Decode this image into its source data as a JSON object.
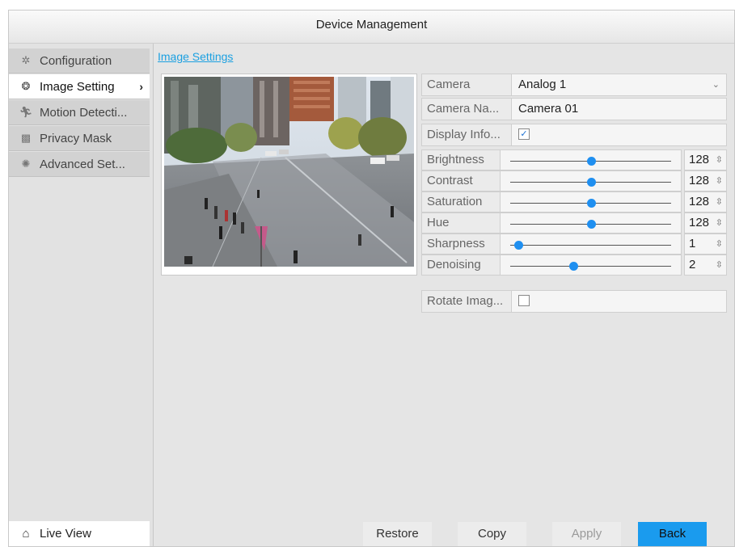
{
  "window": {
    "title": "Device Management"
  },
  "sidebar": {
    "items": [
      {
        "label": "Configuration",
        "icon": "gear-icon"
      },
      {
        "label": "Image Setting",
        "icon": "palette-icon",
        "active": true
      },
      {
        "label": "Motion Detecti...",
        "icon": "running-person-icon"
      },
      {
        "label": "Privacy Mask",
        "icon": "mask-icon"
      },
      {
        "label": "Advanced Set...",
        "icon": "advanced-gear-icon"
      }
    ],
    "live_view": {
      "label": "Live View",
      "icon": "home-icon"
    }
  },
  "breadcrumb": "Image Settings",
  "form": {
    "camera": {
      "label": "Camera",
      "value": "Analog 1"
    },
    "camera_name": {
      "label": "Camera Na...",
      "value": "Camera 01"
    },
    "display_info": {
      "label": "Display Info...",
      "checked": true,
      "check_glyph": "✓"
    },
    "sliders": [
      {
        "label": "Brightness",
        "value": "128",
        "fraction": 0.5
      },
      {
        "label": "Contrast",
        "value": "128",
        "fraction": 0.5
      },
      {
        "label": "Saturation",
        "value": "128",
        "fraction": 0.5
      },
      {
        "label": "Hue",
        "value": "128",
        "fraction": 0.5
      },
      {
        "label": "Sharpness",
        "value": "1",
        "fraction": 0.05
      },
      {
        "label": "Denoising",
        "value": "2",
        "fraction": 0.39
      }
    ],
    "rotate_image": {
      "label": "Rotate Imag...",
      "checked": false
    }
  },
  "buttons": {
    "restore": "Restore",
    "copy": "Copy",
    "apply": "Apply",
    "back": "Back"
  },
  "colors": {
    "accent": "#1a9bee",
    "link": "#1ba0e1",
    "knob": "#1f8ff0"
  }
}
